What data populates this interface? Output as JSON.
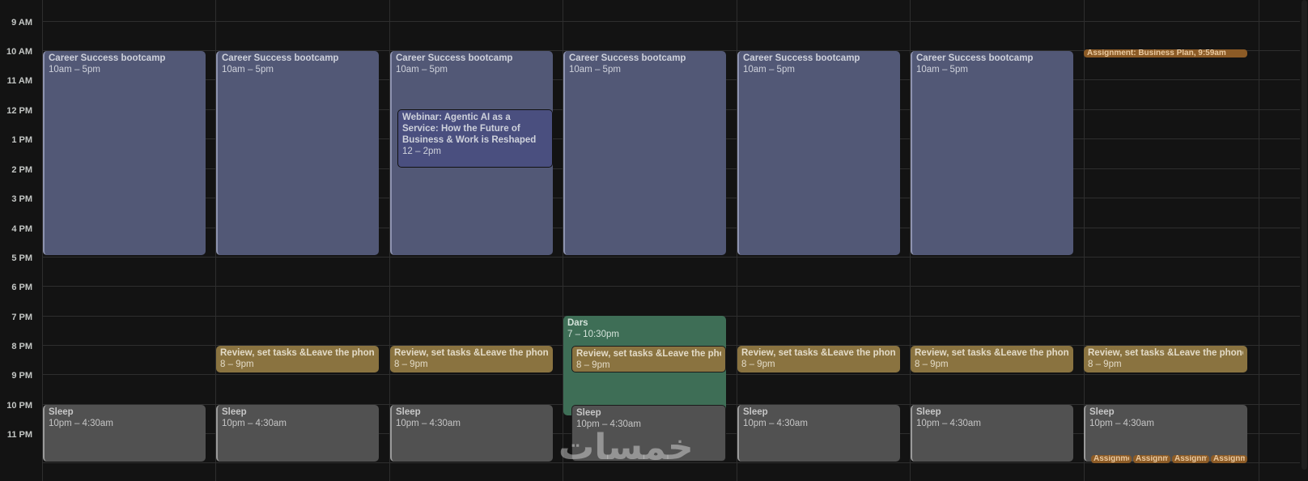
{
  "time_labels": [
    "9 AM",
    "10 AM",
    "11 AM",
    "12 PM",
    "1 PM",
    "2 PM",
    "3 PM",
    "4 PM",
    "5 PM",
    "6 PM",
    "7 PM",
    "8 PM",
    "9 PM",
    "10 PM",
    "11 PM"
  ],
  "events": {
    "career": {
      "title": "Career Success bootcamp",
      "time": "10am – 5pm"
    },
    "review": {
      "title": "Review, set tasks &Leave the phone",
      "time": "8 – 9pm"
    },
    "sleep": {
      "title": "Sleep",
      "time": "10pm – 4:30am"
    },
    "webinar": {
      "title": "Webinar: Agentic AI as a Service: How the Future of Business & Work is Reshaped",
      "time": "12 – 2pm"
    },
    "dars": {
      "title": "Dars",
      "time": "7 – 10:30pm"
    },
    "assignment": {
      "title": "Assignment: Business Plan, 9:59am"
    },
    "assignment_chip": {
      "title": "Assignme"
    }
  },
  "colors": {
    "background": "#131313",
    "career": "#525876",
    "review": "#8a7340",
    "sleep": "#515151",
    "webinar": "#4a4f7f",
    "dars": "#3e6e56",
    "assignment": "#8c5b26"
  },
  "watermark": "خمسات"
}
